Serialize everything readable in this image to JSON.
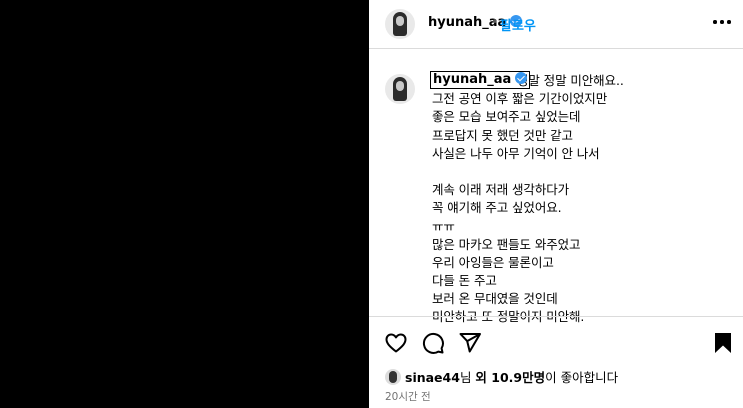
{
  "post": {
    "username": "hyunah_aa",
    "follow_label": "팔로우",
    "separator": "•"
  },
  "caption": {
    "username": "hyunah_aa",
    "lines": [
      "정말 정말 미안해요..",
      "그전 공연 이후 짧은 기간이었지만",
      "좋은 모습 보여주고 싶었는데",
      "프로답지 못 했던 것만 같고",
      "사실은 나두 아무 기억이 안 나서",
      "",
      "계속 이래 저래 생각하다가",
      "꼭 얘기해 주고 싶었어요.",
      "ㅠㅠ",
      "많은 마카오 팬들도 와주었고",
      "우리 아잉들은 물론이고",
      "다들 돈 주고",
      "보러 온 무대였을 것인데",
      "미안하고 또 정말이지 미안해."
    ]
  },
  "likes": {
    "user": "sinae44",
    "mid": "님 ",
    "others": "외 10.9만명",
    "suffix": "이 좋아합니다"
  },
  "time": "20시간 전",
  "icons": {
    "like": "heart-icon",
    "comment": "comment-icon",
    "share": "share-icon",
    "save": "bookmark-icon",
    "more": "more-options-icon",
    "verified": "verified-badge-icon"
  },
  "colors": {
    "accent": "#0095f6",
    "verified": "#3797f0",
    "muted": "#737373"
  }
}
